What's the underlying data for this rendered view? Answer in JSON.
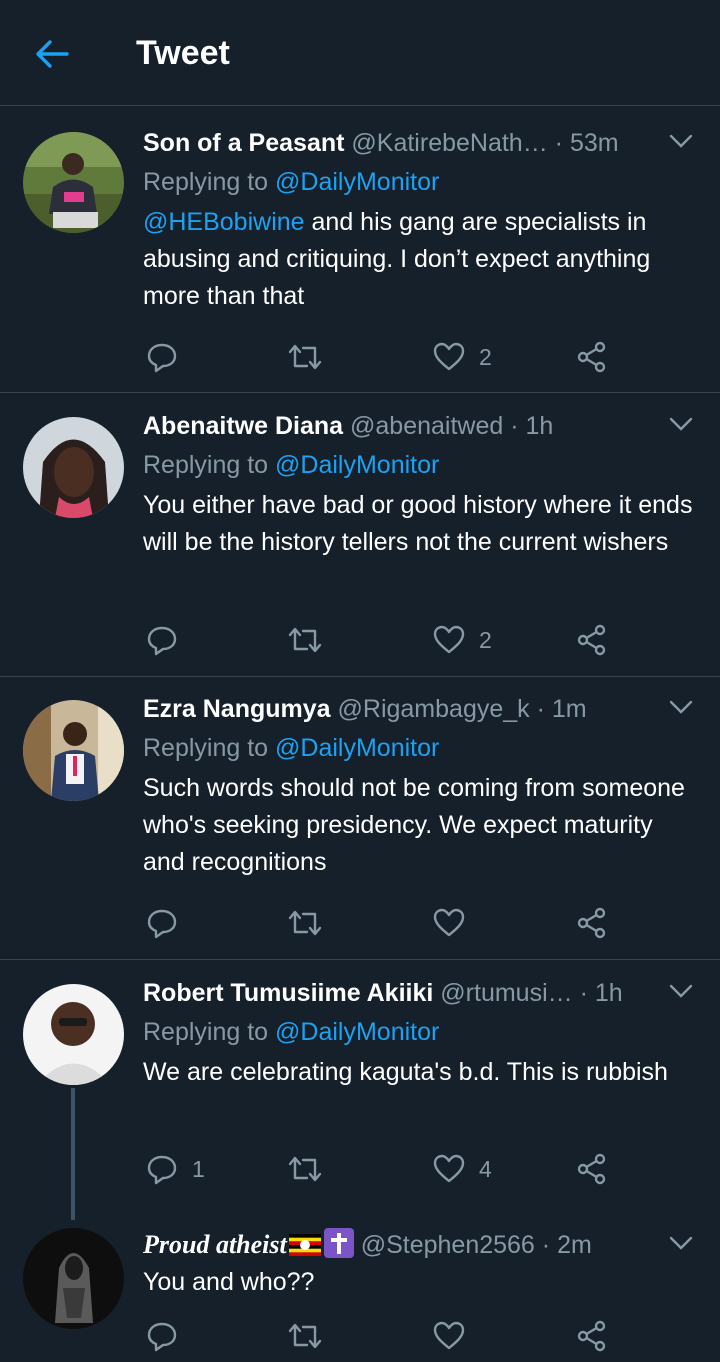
{
  "header": {
    "title": "Tweet"
  },
  "reply_prefix": "Replying to ",
  "tweets": [
    {
      "name": "Son of a Peasant",
      "handle": "@KatirebeNath…",
      "time": "53m",
      "reply_to": "@DailyMonitor",
      "mention": "@HEBobiwine",
      "text": " and his gang are specialists in abusing and critiquing. I don’t expect anything more than that",
      "replies": "",
      "likes": "2"
    },
    {
      "name": "Abenaitwe Diana",
      "handle": "@abenaitwed",
      "time": "1h",
      "reply_to": "@DailyMonitor",
      "text": "You either have bad or good history where it ends will be the history tellers not the current wishers",
      "replies": "",
      "likes": "2"
    },
    {
      "name": "Ezra Nangumya",
      "handle": "@Rigambagye_k",
      "time": "1m",
      "reply_to": "@DailyMonitor",
      "text": "Such words should not be coming from someone who's seeking presidency. We expect maturity and recognitions",
      "replies": "",
      "likes": ""
    },
    {
      "name": "Robert Tumusiime Akiiki",
      "handle": "@rtumusi…",
      "time": "1h",
      "reply_to": "@DailyMonitor",
      "text": "We are celebrating kaguta's b.d. This is rubbish",
      "replies": "1",
      "likes": "4"
    },
    {
      "name": "Proud atheist",
      "handle": "@Stephen2566",
      "time": "2m",
      "text": "You and who??",
      "replies": "",
      "likes": ""
    }
  ],
  "separator": " · "
}
